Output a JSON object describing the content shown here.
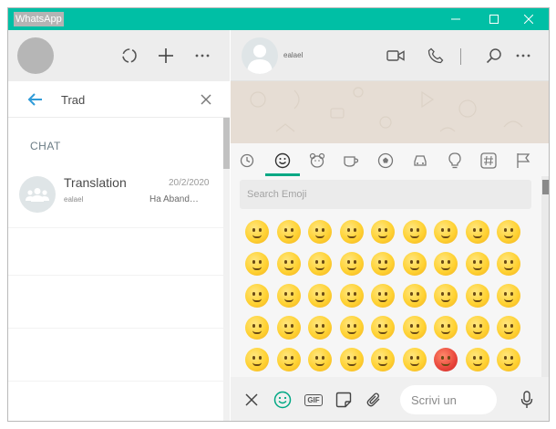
{
  "app": {
    "title": "WhatsApp"
  },
  "window_controls": {
    "minimize_icon": "minimize-icon",
    "maximize_icon": "maximize-icon",
    "close_icon": "close-icon"
  },
  "colors": {
    "accent": "#00bfa5",
    "active_tab": "#00a884",
    "header_bg": "#ededed"
  },
  "left_header": {
    "icons": [
      "status-icon",
      "new-chat-icon",
      "menu-icon"
    ]
  },
  "search": {
    "value": "Trad",
    "clear_icon": "close-icon",
    "back_icon": "arrow-left-icon"
  },
  "chats_section": {
    "label": "CHAT"
  },
  "chats": [
    {
      "name": "Translation",
      "date": "20/2/2020",
      "sender": "ealael",
      "preview": "Ha Aband…",
      "avatar_icon": "group-icon"
    }
  ],
  "conversation": {
    "contact_name": "ealael",
    "header_icons": [
      "video-call-icon",
      "voice-call-icon",
      "search-icon",
      "menu-icon"
    ]
  },
  "emoji_panel": {
    "categories": [
      "recent-icon",
      "smiley-icon",
      "animal-icon",
      "food-icon",
      "activity-icon",
      "travel-icon",
      "objects-icon",
      "symbols-icon",
      "flags-icon"
    ],
    "active_category": 1,
    "search_placeholder": "Search Emoji",
    "rows": [
      [
        "☺️",
        "😊",
        "😇",
        "🙂",
        "🙃",
        "😉",
        "😌",
        "😍",
        "🥰"
      ],
      [
        "😘",
        "😗",
        "😙",
        "😚",
        "😋",
        "😛",
        "😝",
        "😜",
        "🤪"
      ],
      [
        "🤨",
        "🧐",
        "🤓",
        "😎",
        "🥸",
        "🤩",
        "🥳",
        "😏",
        "😒"
      ],
      [
        "😞",
        "😔",
        "😟",
        "😕",
        "🙁",
        "☹️",
        "😣",
        "😖",
        "😫"
      ],
      [
        "😩",
        "🥺",
        "😢",
        "😭",
        "😤",
        "😠",
        "😡",
        "🤬",
        "🤯"
      ]
    ]
  },
  "composer": {
    "icons": [
      "close-icon",
      "emoji-icon",
      "gif-icon",
      "sticker-icon",
      "attach-icon",
      "microphone-icon"
    ],
    "gif_label": "GIF",
    "placeholder": "Scrivi un"
  }
}
